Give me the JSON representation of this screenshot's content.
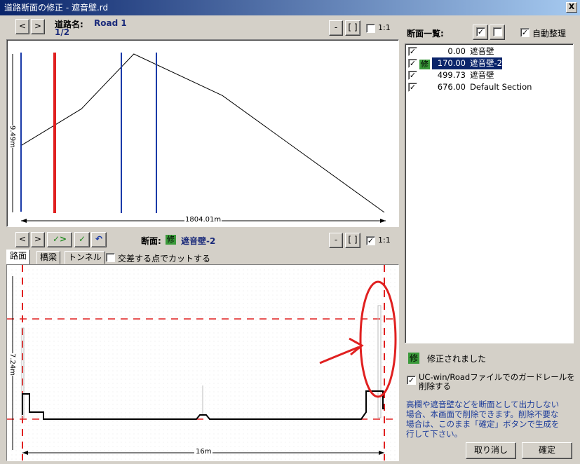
{
  "window": {
    "title": "道路断面の修正 - 遮音壁.rd",
    "close_glyph": "X"
  },
  "top_panel": {
    "road_label": "道路名:",
    "road_name": "Road 1",
    "page": "1/2",
    "prev_glyph": "<",
    "next_glyph": ">",
    "minus_glyph": "-",
    "fit_glyph": "[ ]",
    "scale_label": "1:1",
    "scale_checked": false,
    "height_dim": "9.49m",
    "length_dim": "1804.01m"
  },
  "bottom_panel": {
    "prev_glyph": "<",
    "next_glyph": ">",
    "check_next_glyph": "✓>",
    "check_glyph": "✓",
    "undo_glyph": "↶",
    "section_label": "断面:",
    "modified_badge": "修",
    "section_name": "遮音壁-2",
    "minus_glyph": "-",
    "fit_glyph": "[ ]",
    "scale_label": "1:1",
    "scale_checked": true,
    "tabs": [
      {
        "label": "路面",
        "active": true
      },
      {
        "label": "橋梁",
        "active": false
      },
      {
        "label": "トンネル",
        "active": false
      }
    ],
    "cut_option": "交差する点でカットする",
    "cut_checked": false,
    "height_dim": "7.24m",
    "width_dim": "16m"
  },
  "side_panel": {
    "title": "断面一覧:",
    "auto_arrange_label": "自動整理",
    "auto_arrange_checked": true,
    "sections": [
      {
        "checked": true,
        "modified": false,
        "station": "0.00",
        "name": "遮音壁",
        "selected": false
      },
      {
        "checked": true,
        "modified": true,
        "station": "170.00",
        "name": "遮音壁-2",
        "selected": true
      },
      {
        "checked": true,
        "modified": false,
        "station": "499.73",
        "name": "遮音壁",
        "selected": false
      },
      {
        "checked": true,
        "modified": false,
        "station": "676.00",
        "name": "Default Section",
        "selected": false
      }
    ],
    "legend_badge": "修",
    "legend_text": "修正されました",
    "guardrail_option_line1": "UC-win/Roadファイルでのガードレールを",
    "guardrail_option_line2": "削除する",
    "guardrail_checked": true,
    "info_lines": [
      "高欄や遮音壁などを断面として出力しない",
      "場合、本画面で削除できます。削除不要な",
      "場合は、このまま「確定」ボタンで生成を",
      "行して下さい。"
    ],
    "cancel_label": "取り消し",
    "ok_label": "確定"
  },
  "colors": {
    "accent_red": "#e02020",
    "accent_blue": "#1a3aa8",
    "modified_green": "#3a9a3a",
    "selection": "#0a246a"
  },
  "chart_data": {
    "type": "line",
    "title": "",
    "xlabel": "1804.01m",
    "ylabel": "9.49m",
    "series": [
      {
        "x": [
          0,
          300,
          560,
          1000,
          1804
        ],
        "values": [
          4.0,
          6.2,
          9.49,
          7.0,
          0.0
        ]
      }
    ]
  }
}
